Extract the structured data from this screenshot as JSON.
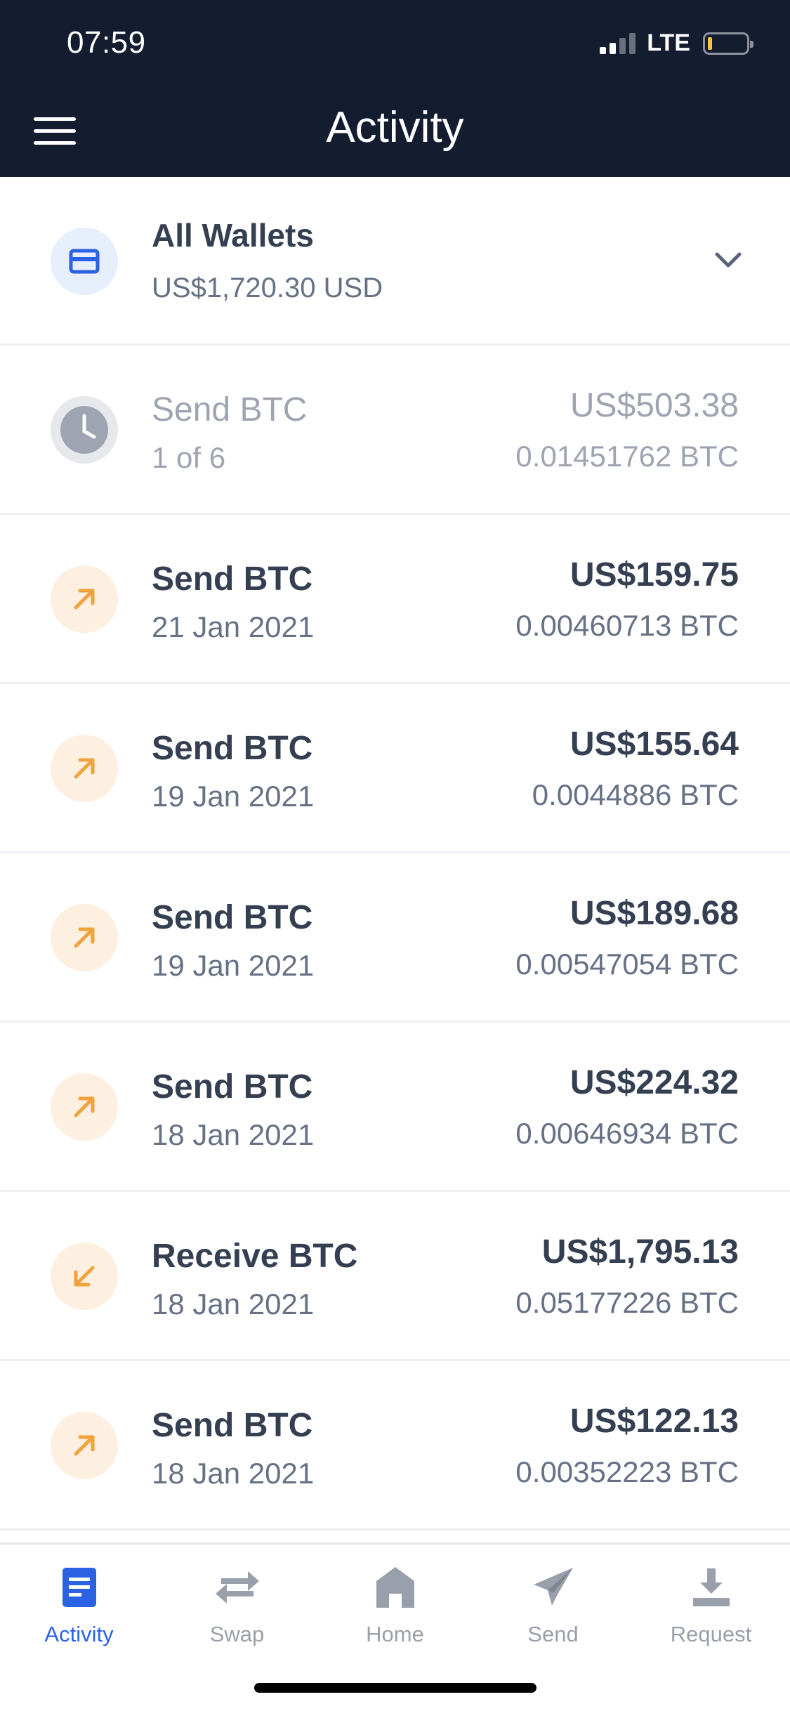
{
  "status_bar": {
    "time": "07:59",
    "network": "LTE",
    "icons": [
      "signal-icon",
      "battery-icon"
    ]
  },
  "header": {
    "title": "Activity",
    "menu_icon": "hamburger-menu-icon"
  },
  "wallet": {
    "title": "All Wallets",
    "balance": "US$1,720.30 USD",
    "icon": "wallet-card-icon",
    "chevron_icon": "chevron-down-icon"
  },
  "transactions": [
    {
      "title": "Send BTC",
      "subtitle": "1 of 6",
      "fiat": "US$503.38",
      "crypto": "0.01451762 BTC",
      "icon": "clock-icon",
      "status": "pending"
    },
    {
      "title": "Send BTC",
      "subtitle": "21 Jan 2021",
      "fiat": "US$159.75",
      "crypto": "0.00460713 BTC",
      "icon": "arrow-up-right-icon",
      "status": "complete"
    },
    {
      "title": "Send BTC",
      "subtitle": "19 Jan 2021",
      "fiat": "US$155.64",
      "crypto": "0.0044886 BTC",
      "icon": "arrow-up-right-icon",
      "status": "complete"
    },
    {
      "title": "Send BTC",
      "subtitle": "19 Jan 2021",
      "fiat": "US$189.68",
      "crypto": "0.00547054 BTC",
      "icon": "arrow-up-right-icon",
      "status": "complete"
    },
    {
      "title": "Send BTC",
      "subtitle": "18 Jan 2021",
      "fiat": "US$224.32",
      "crypto": "0.00646934 BTC",
      "icon": "arrow-up-right-icon",
      "status": "complete"
    },
    {
      "title": "Receive BTC",
      "subtitle": "18 Jan 2021",
      "fiat": "US$1,795.13",
      "crypto": "0.05177226 BTC",
      "icon": "arrow-down-left-icon",
      "status": "complete"
    },
    {
      "title": "Send BTC",
      "subtitle": "18 Jan 2021",
      "fiat": "US$122.13",
      "crypto": "0.00352223 BTC",
      "icon": "arrow-up-right-icon",
      "status": "complete"
    }
  ],
  "tabbar": {
    "active": "Activity",
    "tabs": [
      {
        "label": "Activity",
        "icon": "activity-icon"
      },
      {
        "label": "Swap",
        "icon": "swap-icon"
      },
      {
        "label": "Home",
        "icon": "home-icon"
      },
      {
        "label": "Send",
        "icon": "send-icon"
      },
      {
        "label": "Request",
        "icon": "request-icon"
      }
    ]
  },
  "colors": {
    "header_bg": "#141c30",
    "accent": "#2b62e3",
    "send_orange": "#f0a23c",
    "pending_gray": "#9ea4b1",
    "text_dark": "#353f52",
    "text_muted": "#677185"
  }
}
